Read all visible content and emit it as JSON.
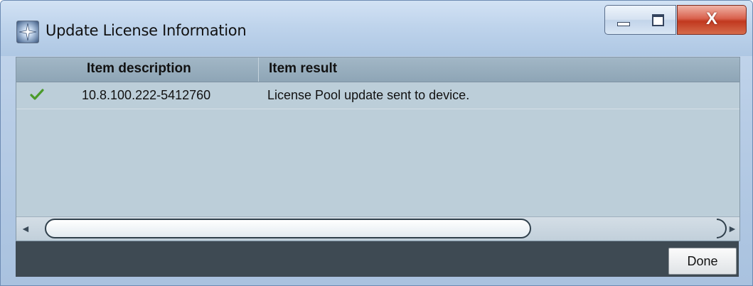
{
  "window": {
    "title": "Update License Information",
    "icon": "app-star-icon",
    "controls": {
      "minimize": "minimize-icon",
      "maximize": "maximize-icon",
      "close": "close-icon",
      "close_glyph": "X"
    }
  },
  "table": {
    "columns": [
      "Item description",
      "Item result"
    ],
    "rows": [
      {
        "status_icon": "checkmark-icon",
        "status_color": "#4a9a2a",
        "description": "10.8.100.222-5412760",
        "result": "License Pool update sent to device."
      }
    ]
  },
  "scrollbar": {
    "left_arrow": "◄",
    "right_arrow": "►"
  },
  "footer": {
    "done_label": "Done"
  }
}
